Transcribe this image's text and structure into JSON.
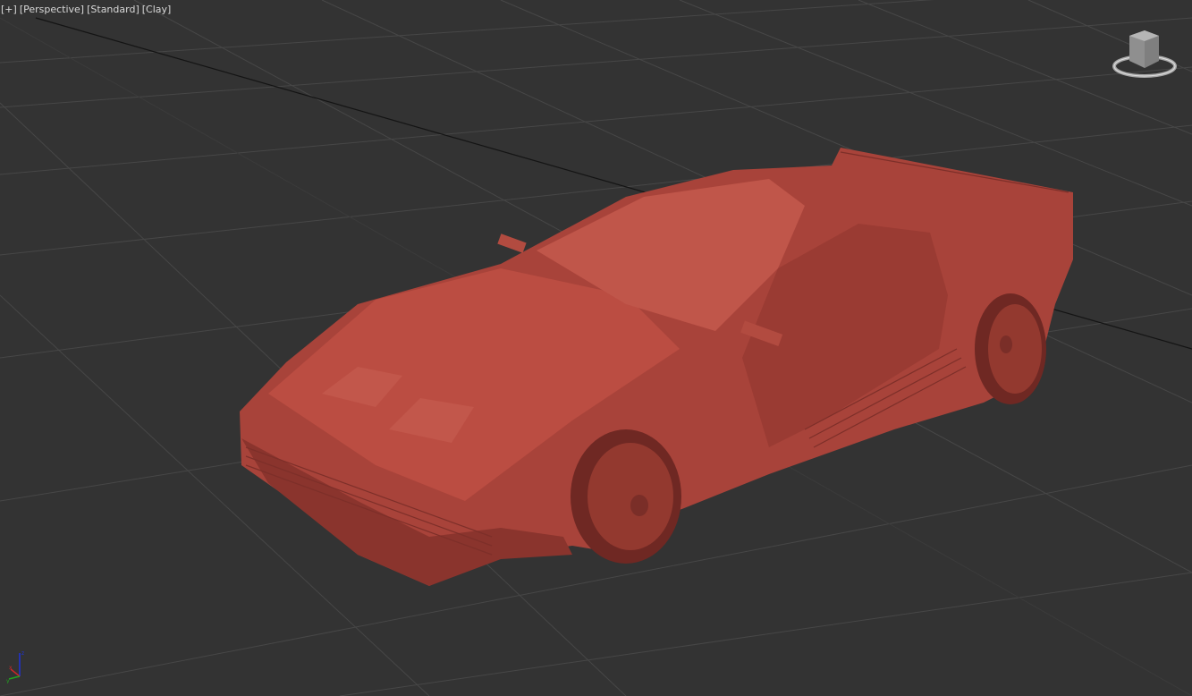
{
  "viewport": {
    "menus": [
      "[+]",
      "[Perspective]",
      "[Standard]",
      "[Clay]"
    ],
    "gizmo_axes": [
      "x",
      "y",
      "z"
    ],
    "colors": {
      "background": "#333333",
      "grid": "#454545",
      "axis_line": "#111111",
      "clay": "#b3473d"
    }
  }
}
